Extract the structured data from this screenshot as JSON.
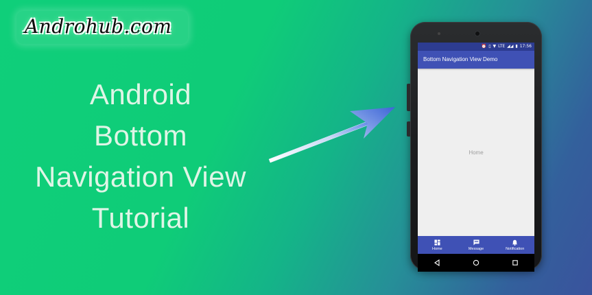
{
  "brand": {
    "text": "Androhub.com"
  },
  "headline": {
    "lines": [
      "Android",
      "Bottom",
      "Navigation View",
      "Tutorial"
    ]
  },
  "phone": {
    "status_time": "17:56",
    "status_network": "LTE",
    "app_title": "Bottom Navigation View Demo",
    "content_label": "Home",
    "bottom_nav": [
      {
        "label": "Home",
        "icon": "dashboard-icon"
      },
      {
        "label": "Message",
        "icon": "message-icon"
      },
      {
        "label": "Notification",
        "icon": "bell-icon"
      }
    ],
    "system_nav": [
      "back-icon",
      "home-circle-icon",
      "recents-icon"
    ]
  },
  "colors": {
    "primary": "#3f51b5",
    "primary_dark": "#2d3c91",
    "background_green": "#0fcf7a",
    "background_blue": "#3a539d"
  }
}
